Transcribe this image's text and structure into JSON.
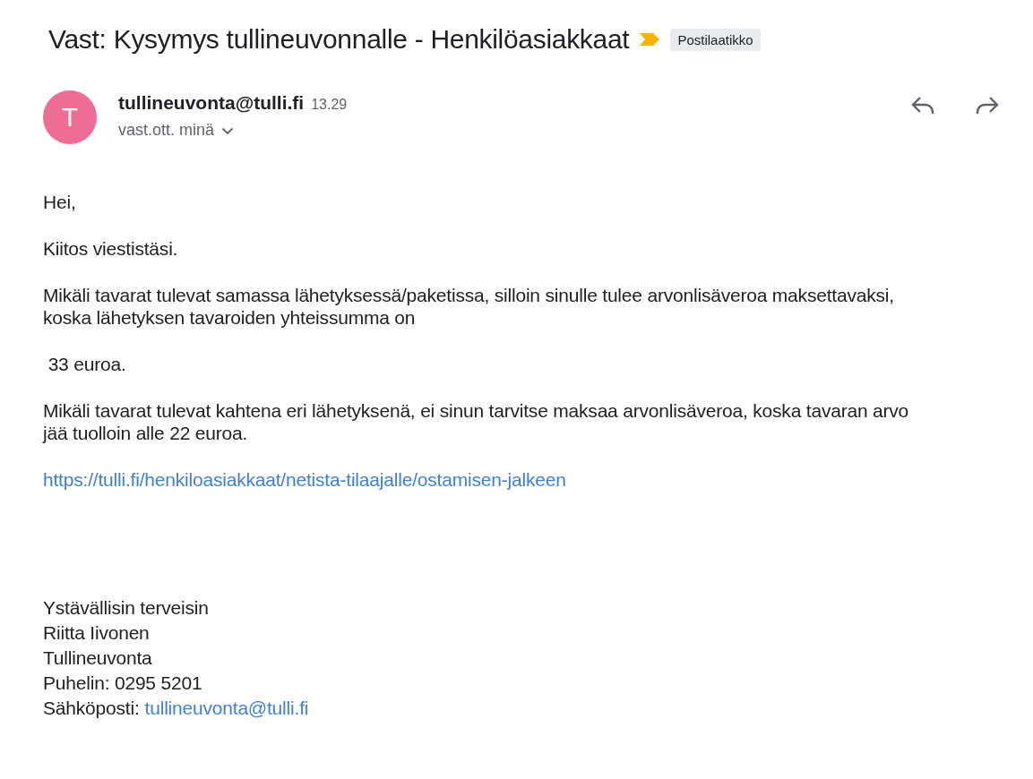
{
  "subject": "Vast: Kysymys tullineuvonnalle - Henkilöasiakkaat",
  "label": "Postilaatikko",
  "important": true,
  "message": {
    "avatar": "T",
    "sender": "tullineuvonta@tulli.fi",
    "time": "13.29",
    "recipients": "vast.ott. minä"
  },
  "body": [
    {
      "kind": "text",
      "lines": [
        "Hei,"
      ]
    },
    {
      "kind": "text",
      "lines": [
        "Kiitos viestistäsi."
      ]
    },
    {
      "kind": "text",
      "lines": [
        "Mikäli tavarat tulevat samassa lähetyksessä/paketissa, silloin sinulle tulee arvonlisäveroa maksettavaksi,",
        "koska lähetyksen tavaroiden yhteissumma on"
      ]
    },
    {
      "kind": "text",
      "lines": [
        " 33 euroa."
      ]
    },
    {
      "kind": "text",
      "lines": [
        "Mikäli tavarat tulevat kahtena eri lähetyksenä, ei sinun tarvitse maksaa arvonlisäveroa, koska tavaran arvo",
        "jää tuolloin alle 22 euroa."
      ]
    },
    {
      "kind": "link",
      "lines": [
        "https://tulli.fi/henkiloasiakkaat/netista-tilaajalle/ostamisen-jalkeen"
      ]
    }
  ],
  "signature": [
    {
      "text": "Ystävällisin terveisin"
    },
    {
      "text": "Riitta Iivonen"
    },
    {
      "text": "Tullineuvonta"
    },
    {
      "text": "Puhelin: 0295 5201"
    },
    {
      "text": "Sähköposti:",
      "link": "tullineuvonta@tulli.fi"
    }
  ]
}
